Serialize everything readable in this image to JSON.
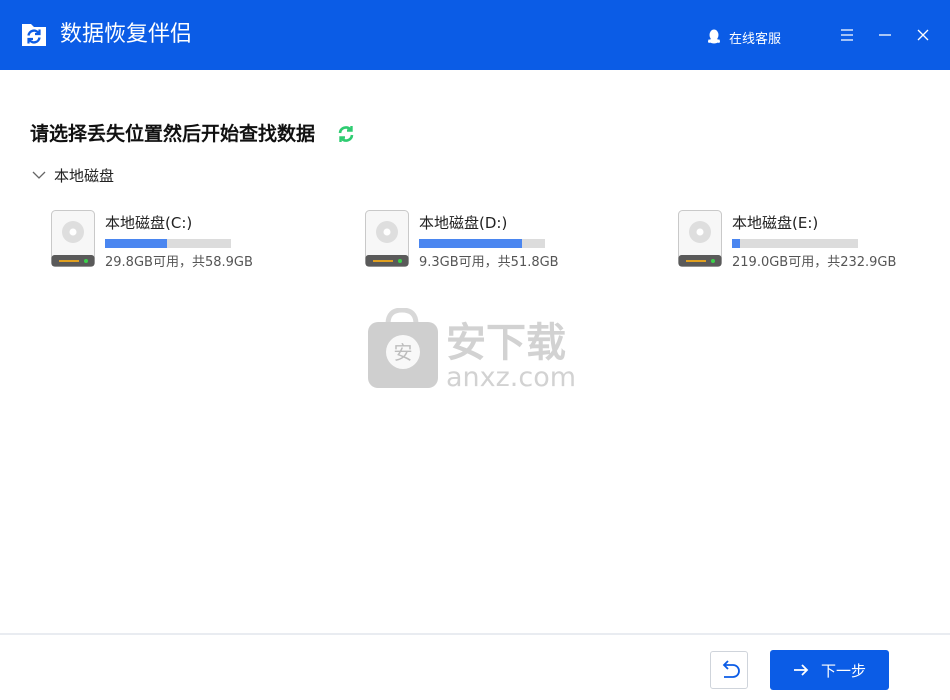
{
  "app": {
    "title": "数据恢复伴侣"
  },
  "header": {
    "support_label": "在线客服"
  },
  "main": {
    "heading": "请选择丢失位置然后开始查找数据",
    "group_label": "本地磁盘",
    "disks": [
      {
        "name": "本地磁盘(C:)",
        "size_text": "29.8GB可用，共58.9GB",
        "used_fraction": 0.49
      },
      {
        "name": "本地磁盘(D:)",
        "size_text": "9.3GB可用，共51.8GB",
        "used_fraction": 0.82
      },
      {
        "name": "本地磁盘(E:)",
        "size_text": "219.0GB可用，共232.9GB",
        "used_fraction": 0.06
      }
    ]
  },
  "watermark": {
    "text_cn": "安下载",
    "text_en": "anxz.com",
    "badge": "安"
  },
  "footer": {
    "next_label": "下一步"
  },
  "colors": {
    "brand": "#0b5ce6",
    "bar": "#4a86f0",
    "refresh": "#2ecc71"
  }
}
